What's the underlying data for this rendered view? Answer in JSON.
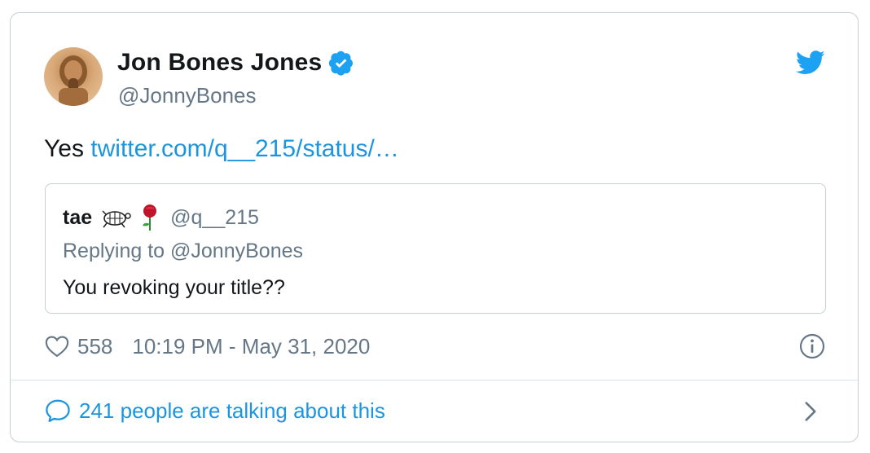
{
  "tweet": {
    "author": {
      "name": "Jon Bones Jones",
      "handle": "@JonnyBones",
      "verified": true
    },
    "text_prefix": "Yes",
    "link_text": "twitter.com/q__215/status/…",
    "quoted": {
      "name": "tae",
      "emojis": [
        "turtle-emoji",
        "rose-emoji"
      ],
      "handle": "@q__215",
      "reply_to": "Replying to @JonnyBones",
      "text": "You revoking your title??"
    },
    "likes": "558",
    "timestamp": "10:19 PM - May 31, 2020",
    "conversation": "241 people are talking about this"
  },
  "colors": {
    "link": "#1b95e0",
    "verified": "#1da1f2",
    "muted": "#657786",
    "text": "#14171a",
    "border": "#c4cfd6"
  }
}
